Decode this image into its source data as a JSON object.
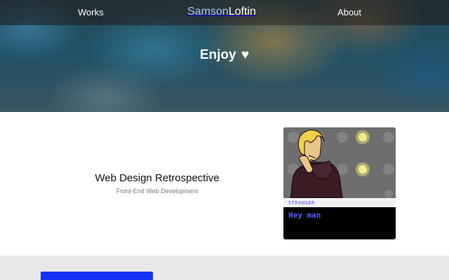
{
  "nav": {
    "works_label": "Works",
    "about_label": "About",
    "logo_first": "Samson",
    "logo_last": "Loftin"
  },
  "hero": {
    "title": "Enjoy",
    "heart_icon": "heart-icon"
  },
  "project": {
    "title": "Web Design Retrospective",
    "subtitle": "Front-End Web Development",
    "preview": {
      "speaker": "STRANGER",
      "dialog": "Hey man"
    }
  },
  "colors": {
    "logo_accent": "#a9c6ff",
    "dialog_text": "#5a5cff",
    "lower_card": "#1533f0",
    "lower_bg": "#e8e8e8"
  }
}
